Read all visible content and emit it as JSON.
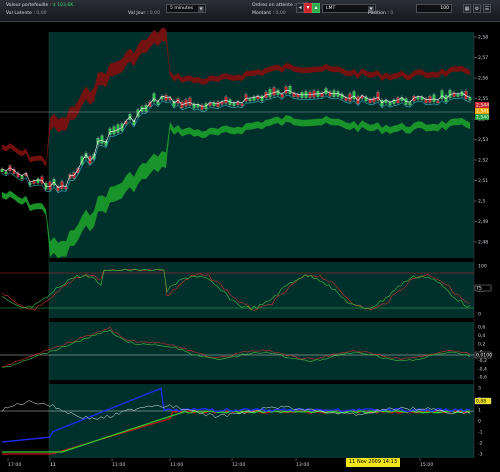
{
  "toolbar": {
    "portfolio_label": "Valeur portefeuille :",
    "portfolio_value": "$ 103,6K",
    "latent_label": "Val Latente :",
    "latent_value": "0,00",
    "day_label": "Val Jour :",
    "day_value": "0,00",
    "interval": "5 minutes",
    "orders_label": "Ordres en attente :",
    "orders_value": "0,00",
    "amount_label": "Montant :",
    "amount_value": "0,00",
    "order_type": "LMT",
    "quantity": "100",
    "position_label": "Position :",
    "position_value": "0"
  },
  "chart_data": {
    "type": "candlestick",
    "price_axis": [
      "2,58",
      "2,57",
      "2,56",
      "2,55",
      "2,54",
      "2,53",
      "2,52",
      "2,51",
      "2,5",
      "2,49",
      "2,48"
    ],
    "price_range": [
      2.477,
      2.585
    ],
    "price_markers": [
      {
        "label": "2,544",
        "color": "#c8232a"
      },
      {
        "label": "2,541",
        "color": "#e8a400"
      },
      {
        "label": "2,540",
        "color": "#1f9c3c"
      }
    ],
    "osc1_axis": [
      "100",
      "50",
      "0"
    ],
    "osc1_marker": "75",
    "osc2_axis": [
      "0,6",
      "0,4",
      "0,2",
      "-0",
      "-0,2",
      "-0,4",
      "-0,6"
    ],
    "osc2_marker": "0,0100",
    "osc3_axis": [
      "3",
      "2",
      "1",
      "0",
      "-1",
      "-2",
      "-3"
    ],
    "osc3_marker": "0,88",
    "time_axis": [
      "17:00",
      "11",
      "11:00",
      "11:00",
      "12:00",
      "13:00",
      "14:00",
      "15:00"
    ],
    "cursor_date": "11 Nov 2009 14:13",
    "colors": {
      "background": "#00302c",
      "candle_up": "#2ec24a",
      "candle_down": "#c8232a",
      "upper_band": "#7a1010",
      "lower_band": "#1a9a2a",
      "price_line": "#ffffff",
      "osc3_blue": "#1e2eff",
      "osc3_magenta": "#d020e0",
      "osc3_green": "#30d030",
      "osc3_red": "#d01010"
    }
  }
}
